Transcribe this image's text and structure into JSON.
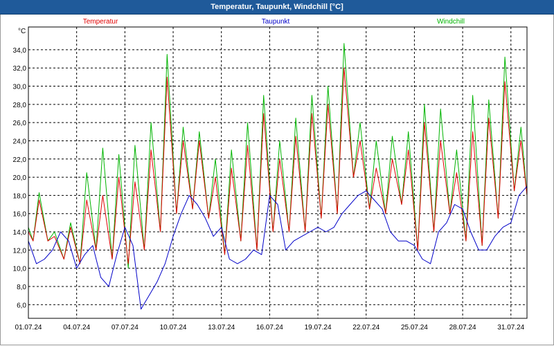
{
  "window": {
    "title": "Temperatur, Taupunkt, Windchill [°C]"
  },
  "chart_data": {
    "type": "line",
    "title": "Temperatur, Taupunkt, Windchill [°C]",
    "ylabel": "°C",
    "ylim": [
      4.5,
      36.5
    ],
    "yticks": [
      6,
      8,
      10,
      12,
      14,
      16,
      18,
      20,
      22,
      24,
      26,
      28,
      30,
      32,
      34
    ],
    "ytick_labels": [
      "6,0",
      "8,0",
      "10,0",
      "12,0",
      "14,0",
      "16,0",
      "18,0",
      "20,0",
      "22,0",
      "24,0",
      "26,0",
      "28,0",
      "30,0",
      "32,0",
      "34,0"
    ],
    "xlim": [
      "2024-07-01",
      "2024-08-01"
    ],
    "xticks": [
      "2024-07-01",
      "2024-07-04",
      "2024-07-07",
      "2024-07-10",
      "2024-07-13",
      "2024-07-16",
      "2024-07-19",
      "2024-07-22",
      "2024-07-25",
      "2024-07-28",
      "2024-07-31"
    ],
    "xtick_labels": [
      "01.07.24",
      "04.07.24",
      "07.07.24",
      "10.07.24",
      "13.07.24",
      "16.07.24",
      "19.07.24",
      "22.07.24",
      "25.07.24",
      "28.07.24",
      "31.07.24"
    ],
    "grid": true,
    "legend_position": "top",
    "series": [
      {
        "name": "Temperatur",
        "color": "#e00000",
        "x": [
          "2024-07-01T00:00",
          "2024-07-01T07:00",
          "2024-07-01T16:00",
          "2024-07-02T05:00",
          "2024-07-02T15:00",
          "2024-07-03T05:00",
          "2024-07-03T15:00",
          "2024-07-04T05:00",
          "2024-07-04T15:00",
          "2024-07-05T05:00",
          "2024-07-05T15:00",
          "2024-07-06T05:00",
          "2024-07-06T15:00",
          "2024-07-07T05:00",
          "2024-07-07T15:00",
          "2024-07-08T05:00",
          "2024-07-08T15:00",
          "2024-07-09T05:00",
          "2024-07-09T15:00",
          "2024-07-10T05:00",
          "2024-07-10T15:00",
          "2024-07-11T05:00",
          "2024-07-11T15:00",
          "2024-07-12T05:00",
          "2024-07-12T15:00",
          "2024-07-13T05:00",
          "2024-07-13T15:00",
          "2024-07-14T05:00",
          "2024-07-14T15:00",
          "2024-07-15T05:00",
          "2024-07-15T15:00",
          "2024-07-16T05:00",
          "2024-07-16T15:00",
          "2024-07-17T05:00",
          "2024-07-17T15:00",
          "2024-07-18T05:00",
          "2024-07-18T15:00",
          "2024-07-19T05:00",
          "2024-07-19T15:00",
          "2024-07-20T05:00",
          "2024-07-20T15:00",
          "2024-07-21T05:00",
          "2024-07-21T15:00",
          "2024-07-22T05:00",
          "2024-07-22T15:00",
          "2024-07-23T05:00",
          "2024-07-23T15:00",
          "2024-07-24T05:00",
          "2024-07-24T15:00",
          "2024-07-25T05:00",
          "2024-07-25T15:00",
          "2024-07-26T05:00",
          "2024-07-26T15:00",
          "2024-07-27T05:00",
          "2024-07-27T15:00",
          "2024-07-28T05:00",
          "2024-07-28T15:00",
          "2024-07-29T05:00",
          "2024-07-29T15:00",
          "2024-07-30T05:00",
          "2024-07-30T15:00",
          "2024-07-31T05:00",
          "2024-07-31T15:00",
          "2024-08-01T00:00"
        ],
        "values": [
          14.0,
          13.0,
          17.5,
          13.0,
          13.5,
          11.0,
          14.5,
          10.5,
          17.5,
          12.0,
          18.0,
          11.0,
          20.0,
          10.5,
          19.5,
          12.0,
          23.0,
          14.0,
          31.0,
          16.0,
          24.0,
          16.5,
          24.0,
          15.5,
          20.0,
          11.5,
          21.0,
          13.0,
          23.5,
          12.0,
          27.0,
          14.0,
          22.0,
          14.0,
          24.5,
          14.0,
          27.0,
          15.5,
          28.0,
          16.0,
          32.0,
          20.0,
          24.0,
          16.5,
          21.0,
          16.0,
          22.0,
          17.0,
          23.0,
          12.0,
          26.0,
          14.0,
          24.0,
          16.0,
          20.5,
          13.0,
          25.0,
          12.5,
          26.5,
          15.5,
          30.5,
          18.5,
          24.0,
          18.0
        ]
      },
      {
        "name": "Taupunkt",
        "color": "#0000c8",
        "x": [
          "2024-07-01T00:00",
          "2024-07-01T12:00",
          "2024-07-02T00:00",
          "2024-07-02T12:00",
          "2024-07-03T00:00",
          "2024-07-03T12:00",
          "2024-07-04T00:00",
          "2024-07-04T12:00",
          "2024-07-05T00:00",
          "2024-07-05T12:00",
          "2024-07-06T00:00",
          "2024-07-06T12:00",
          "2024-07-07T00:00",
          "2024-07-07T12:00",
          "2024-07-08T00:00",
          "2024-07-08T12:00",
          "2024-07-09T00:00",
          "2024-07-09T12:00",
          "2024-07-10T00:00",
          "2024-07-10T12:00",
          "2024-07-11T00:00",
          "2024-07-11T12:00",
          "2024-07-12T00:00",
          "2024-07-12T12:00",
          "2024-07-13T00:00",
          "2024-07-13T12:00",
          "2024-07-14T00:00",
          "2024-07-14T12:00",
          "2024-07-15T00:00",
          "2024-07-15T12:00",
          "2024-07-16T00:00",
          "2024-07-16T12:00",
          "2024-07-17T00:00",
          "2024-07-17T12:00",
          "2024-07-18T00:00",
          "2024-07-18T12:00",
          "2024-07-19T00:00",
          "2024-07-19T12:00",
          "2024-07-20T00:00",
          "2024-07-20T12:00",
          "2024-07-21T00:00",
          "2024-07-21T12:00",
          "2024-07-22T00:00",
          "2024-07-22T12:00",
          "2024-07-23T00:00",
          "2024-07-23T12:00",
          "2024-07-24T00:00",
          "2024-07-24T12:00",
          "2024-07-25T00:00",
          "2024-07-25T12:00",
          "2024-07-26T00:00",
          "2024-07-26T12:00",
          "2024-07-27T00:00",
          "2024-07-27T12:00",
          "2024-07-28T00:00",
          "2024-07-28T12:00",
          "2024-07-29T00:00",
          "2024-07-29T12:00",
          "2024-07-30T00:00",
          "2024-07-30T12:00",
          "2024-07-31T00:00",
          "2024-07-31T12:00",
          "2024-08-01T00:00"
        ],
        "values": [
          13.0,
          10.5,
          11.0,
          12.0,
          14.0,
          13.0,
          10.0,
          11.5,
          12.5,
          9.0,
          8.0,
          11.5,
          14.5,
          12.5,
          5.5,
          7.0,
          8.5,
          10.5,
          13.5,
          16.0,
          18.0,
          17.0,
          15.5,
          13.5,
          14.5,
          11.0,
          10.5,
          11.0,
          12.0,
          11.5,
          18.0,
          17.0,
          12.0,
          13.0,
          13.5,
          14.0,
          14.5,
          14.0,
          14.5,
          16.0,
          17.0,
          18.0,
          18.5,
          17.5,
          16.5,
          14.0,
          13.0,
          13.0,
          12.5,
          11.0,
          10.5,
          14.0,
          15.0,
          17.0,
          16.5,
          14.0,
          12.0,
          12.0,
          13.5,
          14.5,
          15.0,
          18.0,
          19.0
        ]
      },
      {
        "name": "Windchill",
        "color": "#00b400",
        "x": [
          "2024-07-01T00:00",
          "2024-07-01T07:00",
          "2024-07-01T16:00",
          "2024-07-02T05:00",
          "2024-07-02T15:00",
          "2024-07-03T05:00",
          "2024-07-03T15:00",
          "2024-07-04T05:00",
          "2024-07-04T15:00",
          "2024-07-05T05:00",
          "2024-07-05T15:00",
          "2024-07-06T05:00",
          "2024-07-06T15:00",
          "2024-07-07T05:00",
          "2024-07-07T15:00",
          "2024-07-08T05:00",
          "2024-07-08T15:00",
          "2024-07-09T05:00",
          "2024-07-09T15:00",
          "2024-07-10T05:00",
          "2024-07-10T15:00",
          "2024-07-11T05:00",
          "2024-07-11T15:00",
          "2024-07-12T05:00",
          "2024-07-12T15:00",
          "2024-07-13T05:00",
          "2024-07-13T15:00",
          "2024-07-14T05:00",
          "2024-07-14T15:00",
          "2024-07-15T05:00",
          "2024-07-15T15:00",
          "2024-07-16T05:00",
          "2024-07-16T15:00",
          "2024-07-17T05:00",
          "2024-07-17T15:00",
          "2024-07-18T05:00",
          "2024-07-18T15:00",
          "2024-07-19T05:00",
          "2024-07-19T15:00",
          "2024-07-20T05:00",
          "2024-07-20T15:00",
          "2024-07-21T05:00",
          "2024-07-21T15:00",
          "2024-07-22T05:00",
          "2024-07-22T15:00",
          "2024-07-23T05:00",
          "2024-07-23T15:00",
          "2024-07-24T05:00",
          "2024-07-24T15:00",
          "2024-07-25T05:00",
          "2024-07-25T15:00",
          "2024-07-26T05:00",
          "2024-07-26T15:00",
          "2024-07-27T05:00",
          "2024-07-27T15:00",
          "2024-07-28T05:00",
          "2024-07-28T15:00",
          "2024-07-29T05:00",
          "2024-07-29T15:00",
          "2024-07-30T05:00",
          "2024-07-30T15:00",
          "2024-07-31T05:00",
          "2024-07-31T15:00",
          "2024-08-01T00:00"
        ],
        "values": [
          14.5,
          13.0,
          18.3,
          13.0,
          14.0,
          11.0,
          15.0,
          10.5,
          20.5,
          12.0,
          23.2,
          11.0,
          22.5,
          10.0,
          23.5,
          12.0,
          26.0,
          14.0,
          33.5,
          16.0,
          25.5,
          16.5,
          25.0,
          15.5,
          22.0,
          11.5,
          23.0,
          13.0,
          26.0,
          12.0,
          29.0,
          14.0,
          24.0,
          14.0,
          26.5,
          14.0,
          29.0,
          15.5,
          30.0,
          16.0,
          34.7,
          20.0,
          26.0,
          16.5,
          24.0,
          16.0,
          24.5,
          17.0,
          25.0,
          12.0,
          28.0,
          14.0,
          27.5,
          16.0,
          23.0,
          13.0,
          29.0,
          12.5,
          28.5,
          15.5,
          33.2,
          18.5,
          25.5,
          18.0
        ]
      }
    ]
  }
}
